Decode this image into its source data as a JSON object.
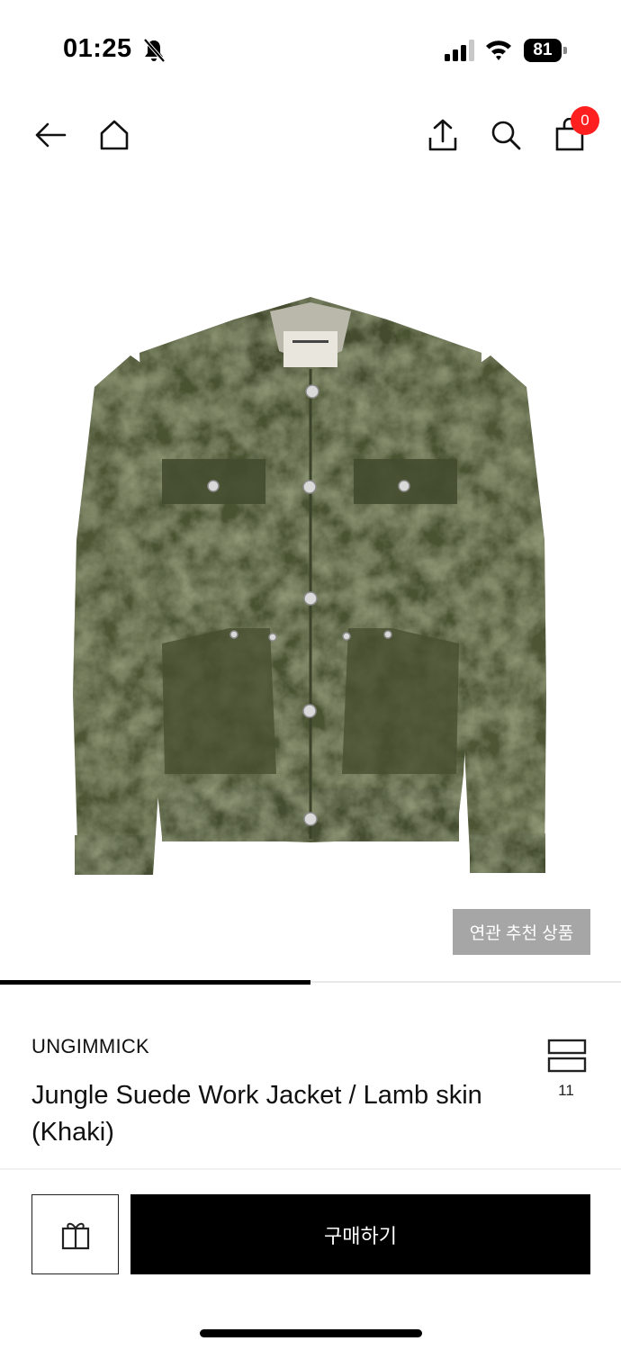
{
  "status_bar": {
    "time": "01:25",
    "battery": "81"
  },
  "nav": {
    "back_icon": "arrow-left-icon",
    "home_icon": "home-icon",
    "share_icon": "share-upload-icon",
    "search_icon": "search-icon",
    "cart_icon": "shopping-bag-icon",
    "cart_count": "0"
  },
  "product": {
    "image_alt": "khaki suede work jacket",
    "related_label": "연관 추천 상품",
    "gallery_progress": 0.5,
    "brand": "UNGIMMICK",
    "title": "Jungle Suede Work Jacket / Lamb skin (Khaki)",
    "like_count": "11"
  },
  "bottom_bar": {
    "gift_icon": "gift-icon",
    "buy_label": "구매하기"
  },
  "colors": {
    "badge": "#ff1f1f",
    "related_bg": "#a6a6a6",
    "jacket": "#4b5434"
  }
}
